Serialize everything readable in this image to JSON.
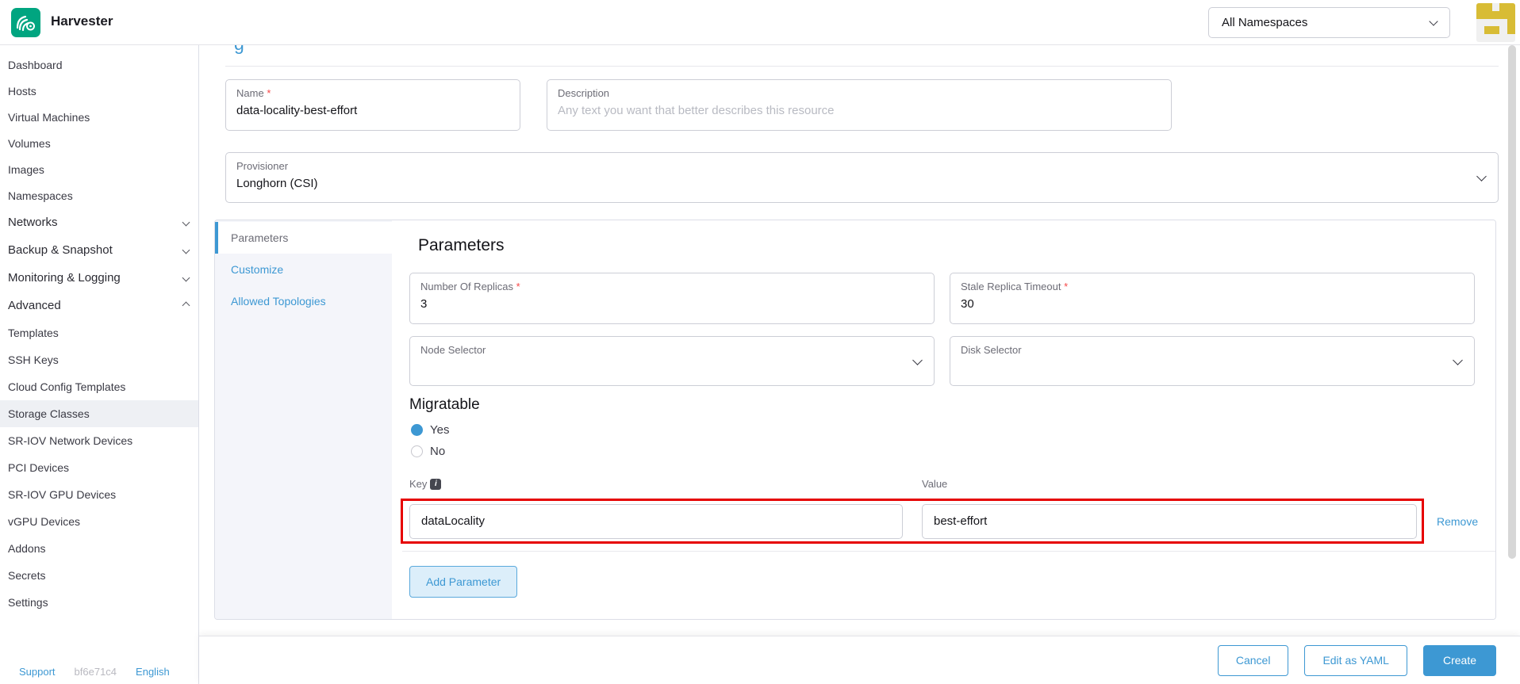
{
  "header": {
    "app_name": "Harvester",
    "namespace_selector": "All Namespaces",
    "avatar_pattern": [
      "11011",
      "11111",
      "00001",
      "01101",
      "00000"
    ]
  },
  "sidebar": {
    "items": [
      {
        "label": "Dashboard"
      },
      {
        "label": "Hosts"
      },
      {
        "label": "Virtual Machines"
      },
      {
        "label": "Volumes"
      },
      {
        "label": "Images"
      },
      {
        "label": "Namespaces"
      },
      {
        "label": "Networks"
      },
      {
        "label": "Backup & Snapshot"
      },
      {
        "label": "Monitoring & Logging"
      },
      {
        "label": "Advanced"
      },
      {
        "label": "Templates"
      },
      {
        "label": "SSH Keys"
      },
      {
        "label": "Cloud Config Templates"
      },
      {
        "label": "Storage Classes"
      },
      {
        "label": "SR-IOV Network Devices"
      },
      {
        "label": "PCI Devices"
      },
      {
        "label": "SR-IOV GPU Devices"
      },
      {
        "label": "vGPU Devices"
      },
      {
        "label": "Addons"
      },
      {
        "label": "Secrets"
      },
      {
        "label": "Settings"
      }
    ],
    "footer": {
      "support": "Support",
      "version": "bf6e71c4",
      "language": "English"
    }
  },
  "page": {
    "clipped_title_fragment": "g"
  },
  "form": {
    "name_field": {
      "label": "Name",
      "required": "*",
      "value": "data-locality-best-effort"
    },
    "description_field": {
      "label": "Description",
      "placeholder": "Any text you want that better describes this resource"
    },
    "provisioner_field": {
      "label": "Provisioner",
      "value": "Longhorn (CSI)"
    },
    "tabs": [
      {
        "label": "Parameters"
      },
      {
        "label": "Customize"
      },
      {
        "label": "Allowed Topologies"
      }
    ],
    "parameters": {
      "heading": "Parameters",
      "replicas": {
        "label": "Number Of Replicas",
        "required": "*",
        "value": "3"
      },
      "stale_timeout": {
        "label": "Stale Replica Timeout",
        "required": "*",
        "value": "30"
      },
      "node_selector": {
        "label": "Node Selector"
      },
      "disk_selector": {
        "label": "Disk Selector"
      },
      "migratable": {
        "heading": "Migratable",
        "options": [
          {
            "label": "Yes"
          },
          {
            "label": "No"
          }
        ]
      },
      "kv": {
        "key_label": "Key",
        "value_label": "Value",
        "key": "dataLocality",
        "value": "best-effort",
        "remove_label": "Remove"
      },
      "add_button": "Add Parameter"
    }
  },
  "footer_actions": {
    "cancel": "Cancel",
    "edit_yaml": "Edit as YAML",
    "create": "Create"
  },
  "icons": {
    "info": "i"
  },
  "colors": {
    "accent": "#3d98d3",
    "brand": "#00a580",
    "annotation": "#e60000",
    "required": "#f64747",
    "avatar": "#d8bc35"
  }
}
